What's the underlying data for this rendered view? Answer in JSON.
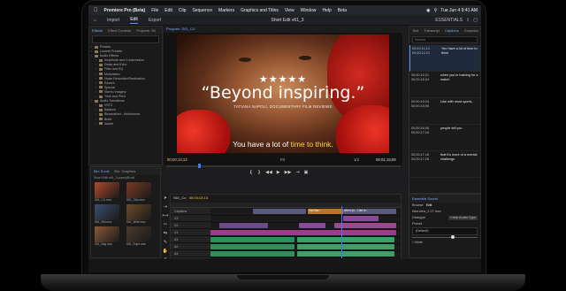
{
  "menubar": {
    "app_name": "Premiere Pro (Beta)",
    "items": [
      "File",
      "Edit",
      "Clip",
      "Sequence",
      "Markers",
      "Graphics and Titles",
      "View",
      "Window",
      "Help",
      "Beta"
    ],
    "clock": "Tue Jun 4  9:41 AM"
  },
  "app_header": {
    "tabs": [
      "Import",
      "Edit",
      "Export"
    ],
    "active_tab": "Edit",
    "title": "Short Edit v61_3",
    "workspace": "ESSENTIALS"
  },
  "effects_panel": {
    "tabs": [
      "Effects",
      "Effect Controls",
      "Projects: S6",
      "Program: S61_Cu"
    ],
    "items": [
      {
        "label": "Presets",
        "indent": 0
      },
      {
        "label": "Lumetri Presets",
        "indent": 0
      },
      {
        "label": "Audio Effects",
        "indent": 0
      },
      {
        "label": "Amplitude and Compression",
        "indent": 1
      },
      {
        "label": "Delay and Echo",
        "indent": 1
      },
      {
        "label": "Filter and EQ",
        "indent": 1
      },
      {
        "label": "Modulation",
        "indent": 1
      },
      {
        "label": "Noise Reduction/Restoration",
        "indent": 1
      },
      {
        "label": "Reverb",
        "indent": 1
      },
      {
        "label": "Special",
        "indent": 1
      },
      {
        "label": "Stereo Imagery",
        "indent": 1
      },
      {
        "label": "Time and Pitch",
        "indent": 1
      },
      {
        "label": "Audio Transitions",
        "indent": 0
      },
      {
        "label": "VST3",
        "indent": 1
      },
      {
        "label": "Balance",
        "indent": 1
      },
      {
        "label": "Binauralizer - Ambisonics",
        "indent": 1
      },
      {
        "label": "Bride",
        "indent": 1
      },
      {
        "label": "Adobe",
        "indent": 1
      }
    ]
  },
  "program_monitor": {
    "tab": "Program: S61_CU",
    "stars": "★★★★★",
    "quote": "“Beyond inspiring.”",
    "byline": "TATIANA NAPOLI, DOCUMENTARY FILM REVIEWS",
    "caption_prefix": "You have a lot of ",
    "caption_highlight": "time to think",
    "caption_suffix": ".",
    "timecode_current": "00;00;13;13",
    "fit": "Fit",
    "zoom": "1/2",
    "timecode_total": "00;01;15;09"
  },
  "captions_panel": {
    "tabs": [
      "Text",
      "Transcript",
      "Captions",
      "Graphics"
    ],
    "active_tab": "Captions",
    "search_placeholder": "Search",
    "rows": [
      {
        "in": "00;00;11;13",
        "out": "00;00;12;21",
        "text": "You have a lot of time to think",
        "selected": true
      },
      {
        "in": "00;00;12;21",
        "out": "00;00;15;04",
        "text": "when you're training for a match",
        "selected": false
      },
      {
        "in": "00;00;15;04",
        "out": "00;00;16;06",
        "text": "Like with most sports,",
        "selected": false
      },
      {
        "in": "00;00;16;06",
        "out": "00;00;17;16",
        "text": "people tell you",
        "selected": false
      },
      {
        "in": "00;00;17;16",
        "out": "00;00;17;28",
        "text": "that it's more of a mental challenge",
        "selected": false
      }
    ]
  },
  "project_bin": {
    "tabs": [
      "Bin: B-roll",
      "Bin: Graphics"
    ],
    "path": "Short Edit v61_3.prproj\\B-roll",
    "clips": [
      {
        "label": "S61_CU.mov",
        "color": "#b04a2c"
      },
      {
        "label": "S61_Glov.mov",
        "color": "#7a3a22"
      },
      {
        "label": "S61_Mid.mov",
        "color": "#3a4f6e"
      },
      {
        "label": "S61_Wide.mov",
        "color": "#6e4a2a"
      },
      {
        "label": "S61_Bag.mov",
        "color": "#8a5a3a"
      },
      {
        "label": "S61_Rope.mov",
        "color": "#4a3a2a"
      }
    ]
  },
  "timeline": {
    "sequence": "S61_Cu",
    "timecode": "00;00;13;13",
    "tracks": [
      {
        "name": "Captions",
        "type": "caption"
      },
      {
        "name": "V3",
        "type": "video"
      },
      {
        "name": "V2",
        "type": "video"
      },
      {
        "name": "V1",
        "type": "video",
        "label": "Video 1"
      },
      {
        "name": "A1",
        "type": "audio"
      },
      {
        "name": "A2",
        "type": "audio"
      },
      {
        "name": "A3",
        "type": "audio"
      }
    ],
    "caption_clip_text": "when yo... Like w...",
    "caption_clip_highlight": "You hav..."
  },
  "essential_sound": {
    "title": "Essential Sound",
    "tabs": [
      "Browse",
      "Edit"
    ],
    "clip_name": "Interview_2.27.mov",
    "type": "Dialogue",
    "clear_label": "Clear Audio Type",
    "preset_label": "Preset",
    "preset_value": "(Default)",
    "mute_label": "Mute"
  }
}
